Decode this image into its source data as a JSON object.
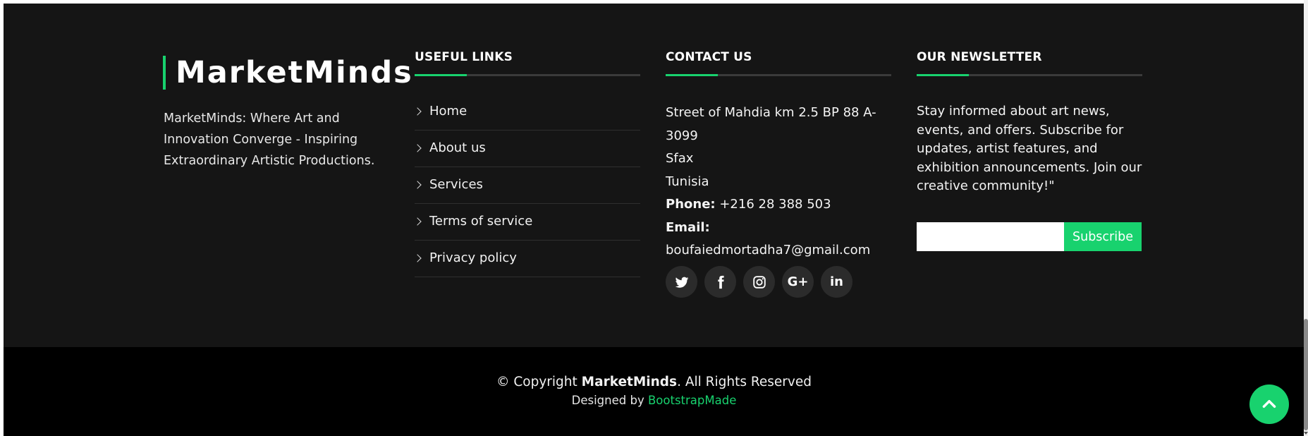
{
  "brand": {
    "name": "MarketMinds",
    "description": "MarketMinds: Where Art and Innovation Converge - Inspiring Extraordinary Artistic Productions."
  },
  "useful_links": {
    "heading": "USEFUL LINKS",
    "items": [
      {
        "label": "Home"
      },
      {
        "label": "About us"
      },
      {
        "label": "Services"
      },
      {
        "label": "Terms of service"
      },
      {
        "label": "Privacy policy"
      }
    ]
  },
  "contact": {
    "heading": "CONTACT US",
    "address_line1": "Street of Mahdia km 2.5 BP 88 A-3099",
    "address_line2": "Sfax",
    "country": "Tunisia",
    "phone_label": "Phone:",
    "phone": "+216 28 388 503",
    "email_label": "Email:",
    "email": "boufaiedmortadha7@gmail.com"
  },
  "social": {
    "icons": [
      "twitter-icon",
      "facebook-icon",
      "instagram-icon",
      "google-plus-icon",
      "linkedin-icon"
    ],
    "google_plus_text": "G+",
    "linkedin_text": "in"
  },
  "newsletter": {
    "heading": "OUR NEWSLETTER",
    "text": "Stay informed about art news, events, and offers. Subscribe for updates, artist features, and exhibition announcements. Join our creative community!\"",
    "email_value": "",
    "email_placeholder": "",
    "subscribe_label": "Subscribe"
  },
  "bottom": {
    "copyright_prefix": "© Copyright ",
    "copyright_brand": "MarketMinds",
    "copyright_suffix": ". All Rights Reserved",
    "designed_by": "Designed by ",
    "designer": "BootstrapMade"
  },
  "colors": {
    "accent": "#18d26e",
    "footer_bg": "#151515",
    "bottom_bg": "#000000"
  }
}
